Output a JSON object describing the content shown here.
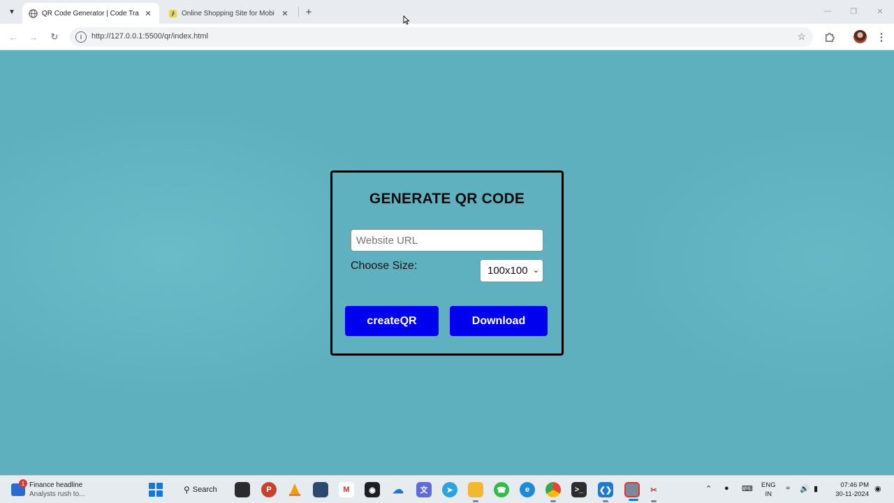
{
  "browser": {
    "tabs": [
      {
        "title": "QR Code Generator | Code Tra",
        "favicon": "globe-icon",
        "active": true
      },
      {
        "title": "Online Shopping Site for Mobi",
        "favicon": "flipkart-icon",
        "active": false
      }
    ],
    "address_bar": {
      "url": "http://127.0.0.1:5500/qr/index.html"
    }
  },
  "page": {
    "title": "GENERATE QR CODE",
    "url_input": {
      "placeholder": "Website URL",
      "value": ""
    },
    "size_label": "Choose Size:",
    "size_select": {
      "selected": "100x100"
    },
    "create_button": "createQR",
    "download_button": "Download"
  },
  "taskbar": {
    "news": {
      "headline": "Finance headline",
      "subtitle": "Analysts rush to...",
      "badge": "1"
    },
    "search_label": "Search",
    "language": {
      "line1": "ENG",
      "line2": "IN"
    },
    "clock": {
      "time": "07:46 PM",
      "date": "30-11-2024"
    }
  },
  "colors": {
    "page_background": "#5eb0bf",
    "button_background": "#0000ee",
    "button_text": "#ffffff",
    "card_border": "#000000"
  }
}
